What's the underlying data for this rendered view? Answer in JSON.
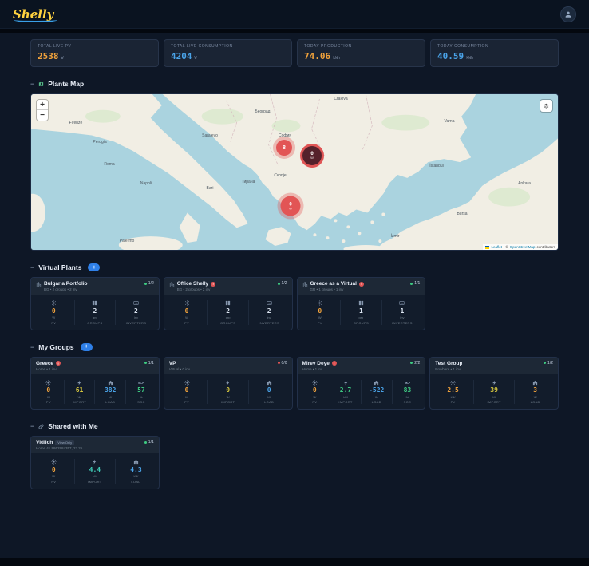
{
  "header": {
    "logo": "Shelly"
  },
  "stats": [
    {
      "label": "TOTAL LIVE PV",
      "value": "2538",
      "unit": "W",
      "color": "orange"
    },
    {
      "label": "TOTAL LIVE CONSUMPTION",
      "value": "4204",
      "unit": "W",
      "color": "blue"
    },
    {
      "label": "TODAY PRODUCTION",
      "value": "74.06",
      "unit": "kWh",
      "color": "orange"
    },
    {
      "label": "TODAY CONSUMPTION",
      "value": "40.59",
      "unit": "kWh",
      "color": "blue"
    }
  ],
  "map_section": {
    "collapse": "−",
    "title": "Plants Map",
    "zoom_in": "+",
    "zoom_out": "−",
    "attribution": {
      "leaflet": "Leaflet",
      "sep": " | © ",
      "osm": "OpenStreetMap",
      "tail": " contributors"
    },
    "markers": [
      {
        "value": "8",
        "unit": ""
      },
      {
        "value": "0",
        "unit": "W"
      },
      {
        "value": "0",
        "unit": "W"
      }
    ],
    "labels": [
      "Craiova",
      "Firenze",
      "Perugia",
      "Roma",
      "Napoli",
      "Bari",
      "Palermo",
      "Sarajevo",
      "Београд",
      "София",
      "Скопје",
      "Тирана",
      "İstanbul",
      "Bursa",
      "Ankara",
      "İzmir",
      "Varna"
    ]
  },
  "virtual_plants_section": {
    "collapse": "−",
    "title": "Virtual Plants",
    "add": "+"
  },
  "virtual_plants": [
    {
      "title": "Bulgaria Portfolio",
      "subtitle": "BG • 2 groups • 2 inv",
      "badge": "1/2",
      "badge_color": "green",
      "stats": [
        {
          "icon": "sun-icon",
          "value": "0",
          "unit": "W",
          "label": "PV",
          "color": "orange"
        },
        {
          "icon": "groups-icon",
          "value": "2",
          "unit": "grp",
          "label": "GROUPS",
          "color": "white"
        },
        {
          "icon": "inverter-icon",
          "value": "2",
          "unit": "inv",
          "label": "INVERTERS",
          "color": "white"
        }
      ]
    },
    {
      "title": "Office Shelly",
      "alert": "!",
      "subtitle": "BG • 2 groups • 2 inv",
      "badge": "1/2",
      "badge_color": "green",
      "stats": [
        {
          "icon": "sun-icon",
          "value": "0",
          "unit": "W",
          "label": "PV",
          "color": "orange"
        },
        {
          "icon": "groups-icon",
          "value": "2",
          "unit": "grp",
          "label": "GROUPS",
          "color": "white"
        },
        {
          "icon": "inverter-icon",
          "value": "2",
          "unit": "inv",
          "label": "INVERTERS",
          "color": "white"
        }
      ]
    },
    {
      "title": "Greece as a Virtual",
      "alert": "!",
      "subtitle": "GR • 1 groups • 1 inv",
      "badge": "1/1",
      "badge_color": "green",
      "stats": [
        {
          "icon": "sun-icon",
          "value": "0",
          "unit": "W",
          "label": "PV",
          "color": "orange"
        },
        {
          "icon": "groups-icon",
          "value": "1",
          "unit": "grp",
          "label": "GROUPS",
          "color": "white"
        },
        {
          "icon": "inverter-icon",
          "value": "1",
          "unit": "inv",
          "label": "INVERTERS",
          "color": "white"
        }
      ]
    }
  ],
  "my_groups_section": {
    "collapse": "−",
    "title": "My Groups",
    "add": "+"
  },
  "my_groups": [
    {
      "title": "Greece",
      "alert": "!",
      "subtitle": "Home • 1 inv",
      "badge": "1/1",
      "badge_color": "green",
      "stats": [
        {
          "icon": "sun-icon",
          "value": "0",
          "unit": "W",
          "label": "PV",
          "color": "orange"
        },
        {
          "icon": "bolt-icon",
          "value": "61",
          "unit": "W",
          "label": "IMPORT",
          "color": "yellow"
        },
        {
          "icon": "home-icon",
          "value": "382",
          "unit": "W",
          "label": "LOAD",
          "color": "blue"
        },
        {
          "icon": "battery-icon",
          "value": "57",
          "unit": "%",
          "label": "SOC",
          "color": "green"
        }
      ]
    },
    {
      "title": "VP",
      "subtitle": "Virtual • 0 inv",
      "badge": "0/0",
      "badge_color": "red",
      "stats": [
        {
          "icon": "sun-icon",
          "value": "0",
          "unit": "W",
          "label": "PV",
          "color": "orange"
        },
        {
          "icon": "bolt-icon",
          "value": "0",
          "unit": "W",
          "label": "IMPORT",
          "color": "yellow"
        },
        {
          "icon": "home-icon",
          "value": "0",
          "unit": "W",
          "label": "LOAD",
          "color": "blue"
        }
      ]
    },
    {
      "title": "Mirev Deye",
      "alert": "!",
      "subtitle": "Home • 1 inv",
      "badge": "2/2",
      "badge_color": "green",
      "stats": [
        {
          "icon": "sun-icon",
          "value": "0",
          "unit": "W",
          "label": "PV",
          "color": "orange"
        },
        {
          "icon": "bolt-icon",
          "value": "2.7",
          "unit": "kW",
          "label": "IMPORT",
          "color": "green"
        },
        {
          "icon": "home-icon",
          "value": "-522",
          "unit": "W",
          "label": "LOAD",
          "color": "blue"
        },
        {
          "icon": "battery-icon",
          "value": "83",
          "unit": "%",
          "label": "SOC",
          "color": "green"
        }
      ]
    },
    {
      "title": "Test Group",
      "subtitle": "Nowhere • 1 inv",
      "badge": "1/2",
      "badge_color": "green",
      "stats": [
        {
          "icon": "sun-icon",
          "value": "2.5",
          "unit": "kW",
          "label": "PV",
          "color": "orange"
        },
        {
          "icon": "bolt-icon",
          "value": "39",
          "unit": "W",
          "label": "IMPORT",
          "color": "yellow"
        },
        {
          "icon": "home-icon",
          "value": "3",
          "unit": "W",
          "label": "LOAD",
          "color": "orange"
        }
      ]
    }
  ],
  "shared_section": {
    "collapse": "−",
    "title": "Shared with Me"
  },
  "shared": [
    {
      "title": "Vidlich",
      "view_badge": "View Only",
      "subtitle": "Home 41.9862984357, 23.25…",
      "badge": "1/1",
      "badge_color": "green",
      "stats": [
        {
          "icon": "sun-icon",
          "value": "0",
          "unit": "W",
          "label": "PV",
          "color": "orange"
        },
        {
          "icon": "bolt-icon",
          "value": "4.4",
          "unit": "kW",
          "label": "IMPORT",
          "color": "teal"
        },
        {
          "icon": "home-icon",
          "value": "4.3",
          "unit": "kW",
          "label": "LOAD",
          "color": "blue"
        }
      ]
    }
  ]
}
